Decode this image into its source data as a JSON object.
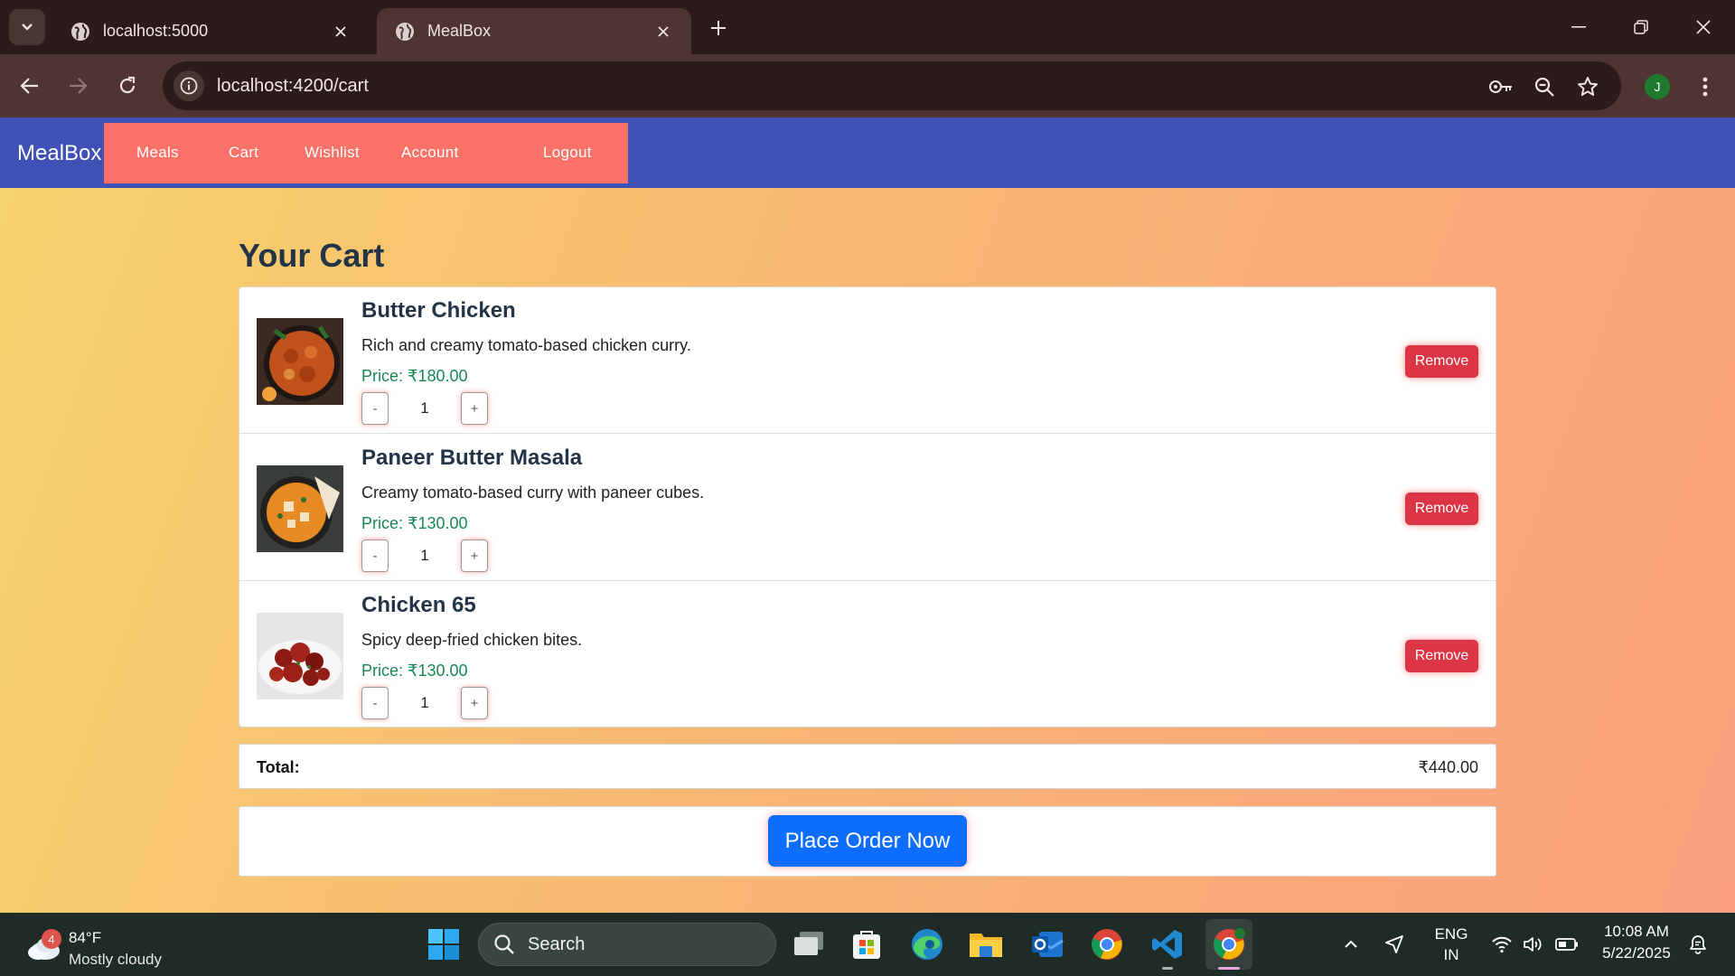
{
  "browser": {
    "tabs": [
      {
        "title": "localhost:5000",
        "active": false
      },
      {
        "title": "MealBox",
        "active": true
      }
    ],
    "url": "localhost:4200/cart",
    "profile_initial": "J"
  },
  "app": {
    "brand": "MealBox",
    "nav": [
      "Meals",
      "Cart",
      "Wishlist",
      "Account",
      "Logout"
    ],
    "colors": {
      "navbar": "#3f51b5",
      "nav_links_bg": "#fa7268",
      "price": "#198754",
      "remove": "#dc3545",
      "order": "#0d6efd"
    }
  },
  "cart": {
    "title": "Your Cart",
    "items": [
      {
        "name": "Butter Chicken",
        "description": "Rich and creamy tomato-based chicken curry.",
        "price": "Price: ₹180.00",
        "quantity": "1",
        "remove_label": "Remove",
        "minus": "-",
        "plus": "+"
      },
      {
        "name": "Paneer Butter Masala",
        "description": "Creamy tomato-based curry with paneer cubes.",
        "price": "Price: ₹130.00",
        "quantity": "1",
        "remove_label": "Remove",
        "minus": "-",
        "plus": "+"
      },
      {
        "name": "Chicken 65",
        "description": "Spicy deep-fried chicken bites.",
        "price": "Price: ₹130.00",
        "quantity": "1",
        "remove_label": "Remove",
        "minus": "-",
        "plus": "+"
      }
    ],
    "total_label": "Total:",
    "total_value": "₹440.00",
    "order_button": "Place Order Now"
  },
  "taskbar": {
    "weather_badge": "4",
    "weather_temp": "84°F",
    "weather_desc": "Mostly cloudy",
    "search_label": "Search",
    "lang_top": "ENG",
    "lang_bottom": "IN",
    "time": "10:08 AM",
    "date": "5/22/2025",
    "apps": [
      "task-view",
      "microsoft-store",
      "edge",
      "file-explorer",
      "outlook",
      "chrome",
      "vs-code",
      "chrome-profile"
    ]
  }
}
